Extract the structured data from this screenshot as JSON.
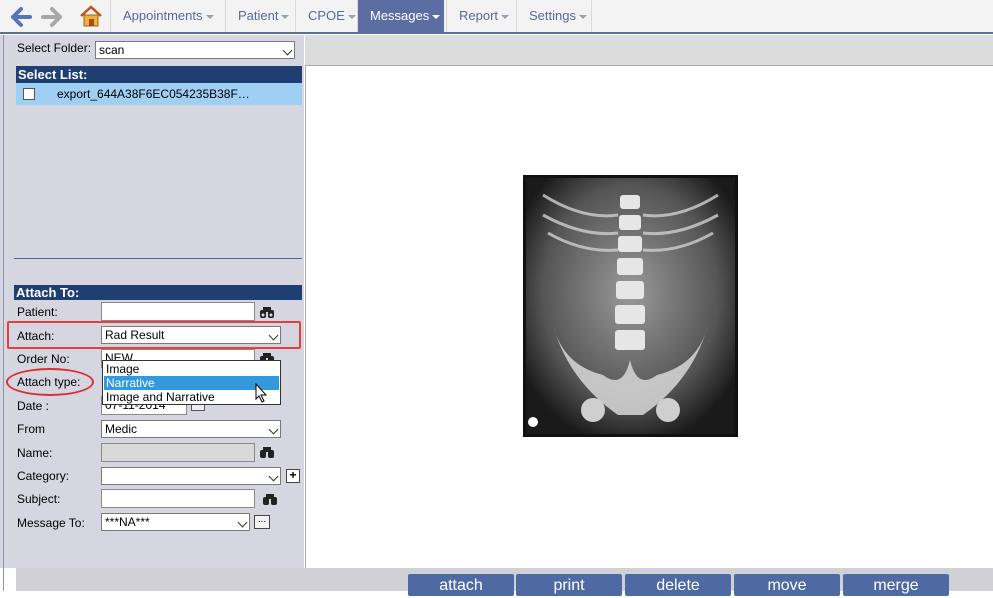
{
  "nav": {
    "menus": [
      "Appointments",
      "Patient",
      "CPOE",
      "Messages",
      "Report",
      "Settings"
    ],
    "active": "Messages"
  },
  "folder": {
    "label": "Select Folder:",
    "value": "scan"
  },
  "select_list": {
    "header": "Select List:",
    "items": [
      {
        "name": "export_644A38F6EC054235B38F…",
        "checked": false
      }
    ]
  },
  "attach_to": {
    "header": "Attach To:",
    "patient_label": "Patient:",
    "patient_value": "",
    "attach_label": "Attach:",
    "attach_value": "Rad Result",
    "order_label": "Order No:",
    "order_value": "NEW",
    "attach_type_label": "Attach type:",
    "attach_type_options": [
      "Image",
      "Narrative",
      "Image and Narrative"
    ],
    "attach_type_highlighted": "Narrative",
    "date_label": "Date  :",
    "date_value": "07-11-2014",
    "from_label": "From",
    "from_value": "Medic",
    "name_label": "Name:",
    "name_value": "",
    "category_label": "Category:",
    "category_value": "",
    "subject_label": "Subject:",
    "subject_value": "",
    "message_to_label": "Message To:",
    "message_to_value": "***NA***"
  },
  "actions": [
    "attach",
    "print",
    "delete",
    "move",
    "merge"
  ],
  "colors": {
    "header_bg": "#1f3f73",
    "active_menu": "#5b6da3",
    "highlight": "#3399dd",
    "annotation_red": "#e04040"
  }
}
